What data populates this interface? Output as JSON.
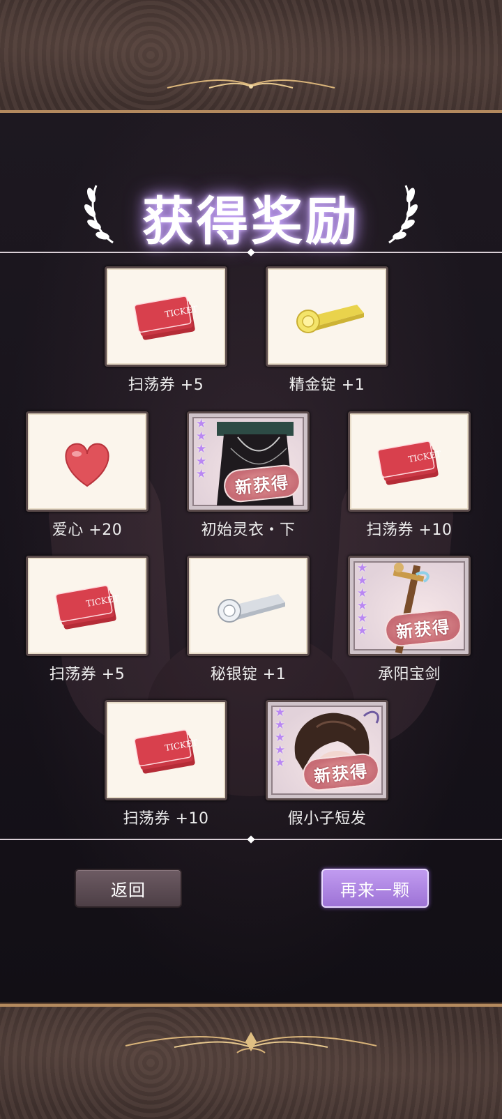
{
  "title": "获得奖励",
  "new_badge": "新获得",
  "rewards": [
    {
      "label": "扫荡券 +5",
      "icon": "ticket-icon",
      "rare": false
    },
    {
      "label": "精金锭 +1",
      "icon": "gold-ingot-icon",
      "rare": false
    },
    {
      "label": "爱心 +20",
      "icon": "heart-icon",
      "rare": false
    },
    {
      "label": "初始灵衣・下",
      "icon": "skirt-garment-icon",
      "rare": true,
      "stars": 5
    },
    {
      "label": "扫荡券 +10",
      "icon": "ticket-icon",
      "rare": false
    },
    {
      "label": "扫荡券 +5",
      "icon": "ticket-icon",
      "rare": false
    },
    {
      "label": "秘银锭 +1",
      "icon": "silver-ingot-icon",
      "rare": false
    },
    {
      "label": "承阳宝剑",
      "icon": "sword-icon",
      "rare": true,
      "stars": 6
    },
    {
      "label": "扫荡券 +10",
      "icon": "ticket-icon",
      "rare": false
    },
    {
      "label": "假小子短发",
      "icon": "short-hair-icon",
      "rare": true,
      "stars": 5
    }
  ],
  "buttons": {
    "back": "返回",
    "again": "再来一颗"
  },
  "ticket_text": "TICKET",
  "colors": {
    "accent_purple": "#b987f2",
    "gold_trim": "#b48a5e",
    "badge_red": "#c76c75"
  }
}
